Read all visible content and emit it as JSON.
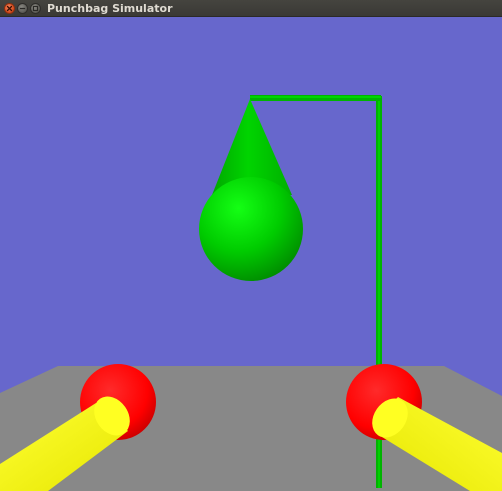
{
  "window": {
    "title": "Punchbag Simulator",
    "buttons": {
      "close": "close-icon",
      "minimize": "minimize-icon",
      "maximize": "maximize-icon"
    }
  },
  "scene": {
    "sky_color": "#6767cc",
    "floor_color": "#888888",
    "bag_color": "#00cc00",
    "stand_color": "#00bb00",
    "glove_color": "#ff0000",
    "arm_color": "#ffff00"
  }
}
